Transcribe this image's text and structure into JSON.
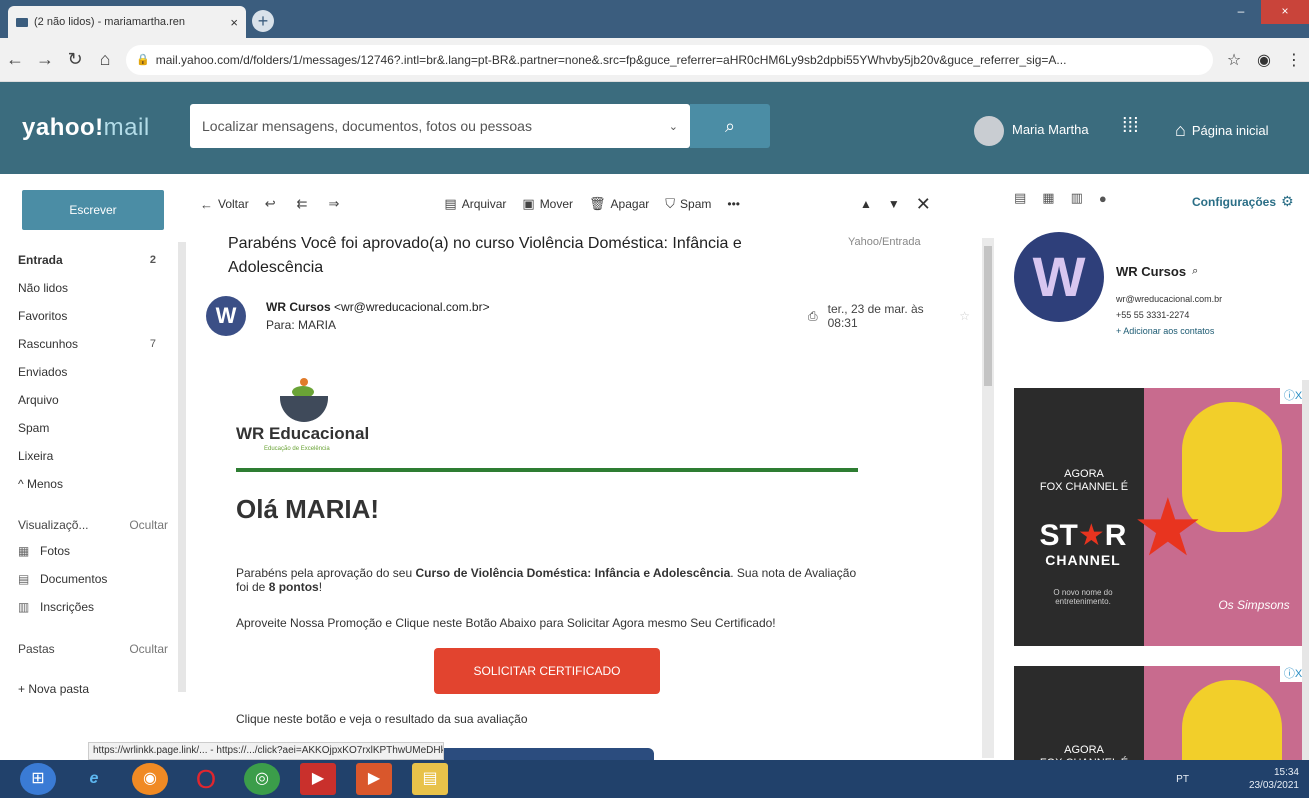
{
  "browser": {
    "tab_title": "(2 não lidos) - mariamartha.ren",
    "url": "mail.yahoo.com/d/folders/1/messages/12746?.intl=br&.lang=pt-BR&.partner=none&.src=fp&guce_referrer=aHR0cHM6Ly9sb2dpbi55YWhvby5jb20v&guce_referrer_sig=A..."
  },
  "header": {
    "logo": "yahoo!",
    "logo_mail": "mail",
    "search_placeholder": "Localizar mensagens, documentos, fotos ou pessoas",
    "user_name": "Maria Martha",
    "home_label": "Página inicial"
  },
  "sidebar": {
    "compose_label": "Escrever",
    "folders": [
      {
        "label": "Entrada",
        "count": "2"
      },
      {
        "label": "Não lidos",
        "count": ""
      },
      {
        "label": "Favoritos",
        "count": ""
      },
      {
        "label": "Rascunhos",
        "count": "7"
      },
      {
        "label": "Enviados",
        "count": ""
      },
      {
        "label": "Arquivo",
        "count": ""
      },
      {
        "label": "Spam",
        "count": ""
      },
      {
        "label": "Lixeira",
        "count": ""
      },
      {
        "label": "^ Menos",
        "count": ""
      }
    ],
    "views_label": "Visualizaçõ...",
    "hide_label": "Ocultar",
    "views": [
      "Fotos",
      "Documentos",
      "Inscrições"
    ],
    "folders_label": "Pastas",
    "new_folder": "+ Nova pasta"
  },
  "toolbar": {
    "back": "Voltar",
    "archive": "Arquivar",
    "move": "Mover",
    "delete": "Apagar",
    "spam": "Spam"
  },
  "message": {
    "subject": "Parabéns Você foi aprovado(a) no curso Violência Doméstica: Infância e Adolescência",
    "folder": "Yahoo/Entrada",
    "sender_name": "WR Cursos",
    "sender_email": "<wr@wreducacional.com.br>",
    "to": "Para: MARIA",
    "date": "ter., 23 de mar. às 08:31"
  },
  "email": {
    "brand": "WR Educacional",
    "brand_tag": "Educação de Excelência",
    "greeting": "Olá MARIA!",
    "p1_pre": "Parabéns pela aprovação do seu ",
    "p1_course": "Curso de Violência Doméstica: Infância e Adolescência",
    "p1_mid": ". Sua nota de Avaliação foi de ",
    "p1_grade": "8 pontos",
    "p1_end": "!",
    "p2": "Aproveite Nossa Promoção e Clique neste Botão Abaixo para Solicitar Agora mesmo Seu Certificado!",
    "cta": "SOLICITAR CERTIFICADO",
    "p3": "Clique neste botão e veja o resultado da sua avaliação"
  },
  "right_panel": {
    "settings": "Configurações",
    "contact_name": "WR Cursos",
    "contact_email": "wr@wreducacional.com.br",
    "contact_phone": "+55 55 3331-2274",
    "add_contact": "+ Adicionar aos contatos"
  },
  "ad": {
    "line1": "AGORA",
    "line2": "FOX CHANNEL É",
    "brand_a": "ST",
    "brand_b": "R",
    "brand_c": "CHANNEL",
    "sub": "O novo nome do entretenimento.",
    "show": "Os Simpsons",
    "badge": "ⓘX"
  },
  "status_url": "https://wrlinkk.page.link/... - https://.../click?aei=AKKOjpxKO7rxlKPThwUMeDHkDm...",
  "taskbar": {
    "lang": "PT",
    "time": "15:34",
    "date": "23/03/2021"
  }
}
